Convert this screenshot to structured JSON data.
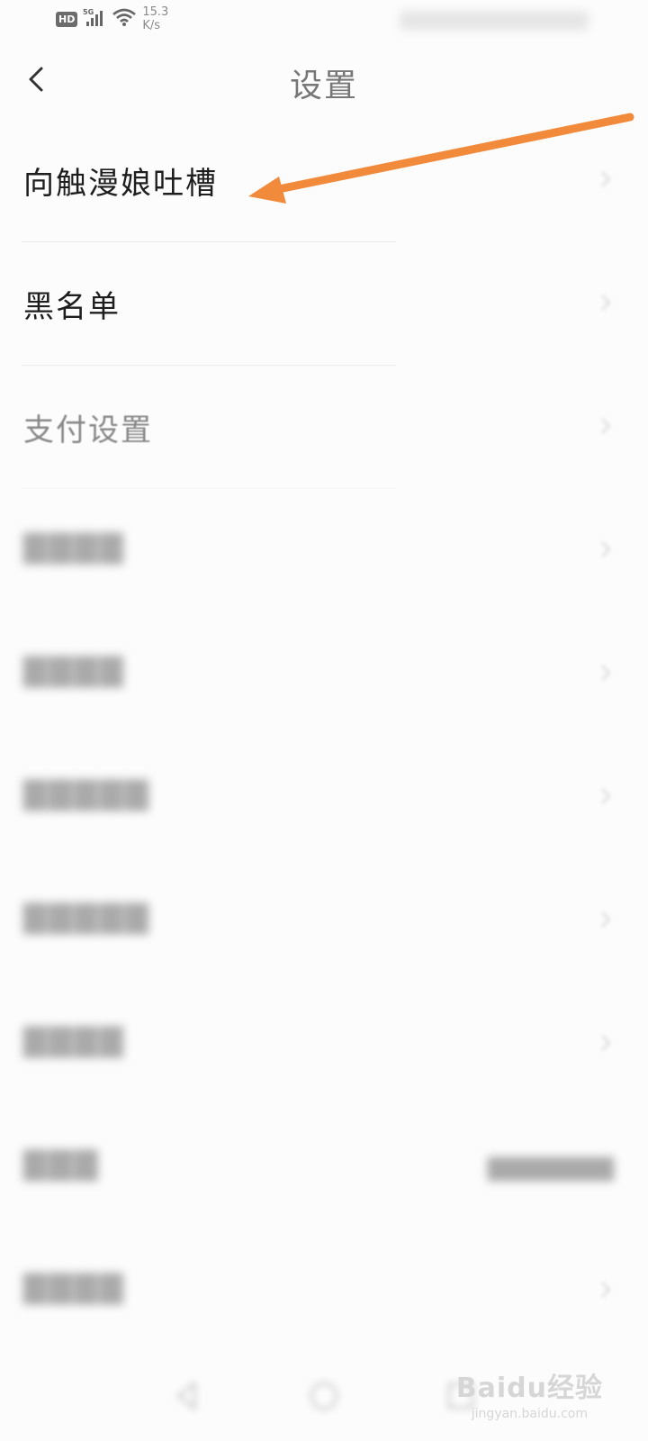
{
  "status_bar": {
    "hd": "HD",
    "network": "5G",
    "speed_value": "15.3",
    "speed_unit": "K/s"
  },
  "header": {
    "title": "设置"
  },
  "items": [
    {
      "label": "向触漫娘吐槽",
      "style": "dark"
    },
    {
      "label": "黑名单",
      "style": "dark"
    },
    {
      "label": "支付设置",
      "style": "mid"
    }
  ],
  "annotation": {
    "arrow_color": "#f28a3c"
  },
  "watermark": {
    "brand": "Baidu经验",
    "url": "jingyan.baidu.com"
  }
}
